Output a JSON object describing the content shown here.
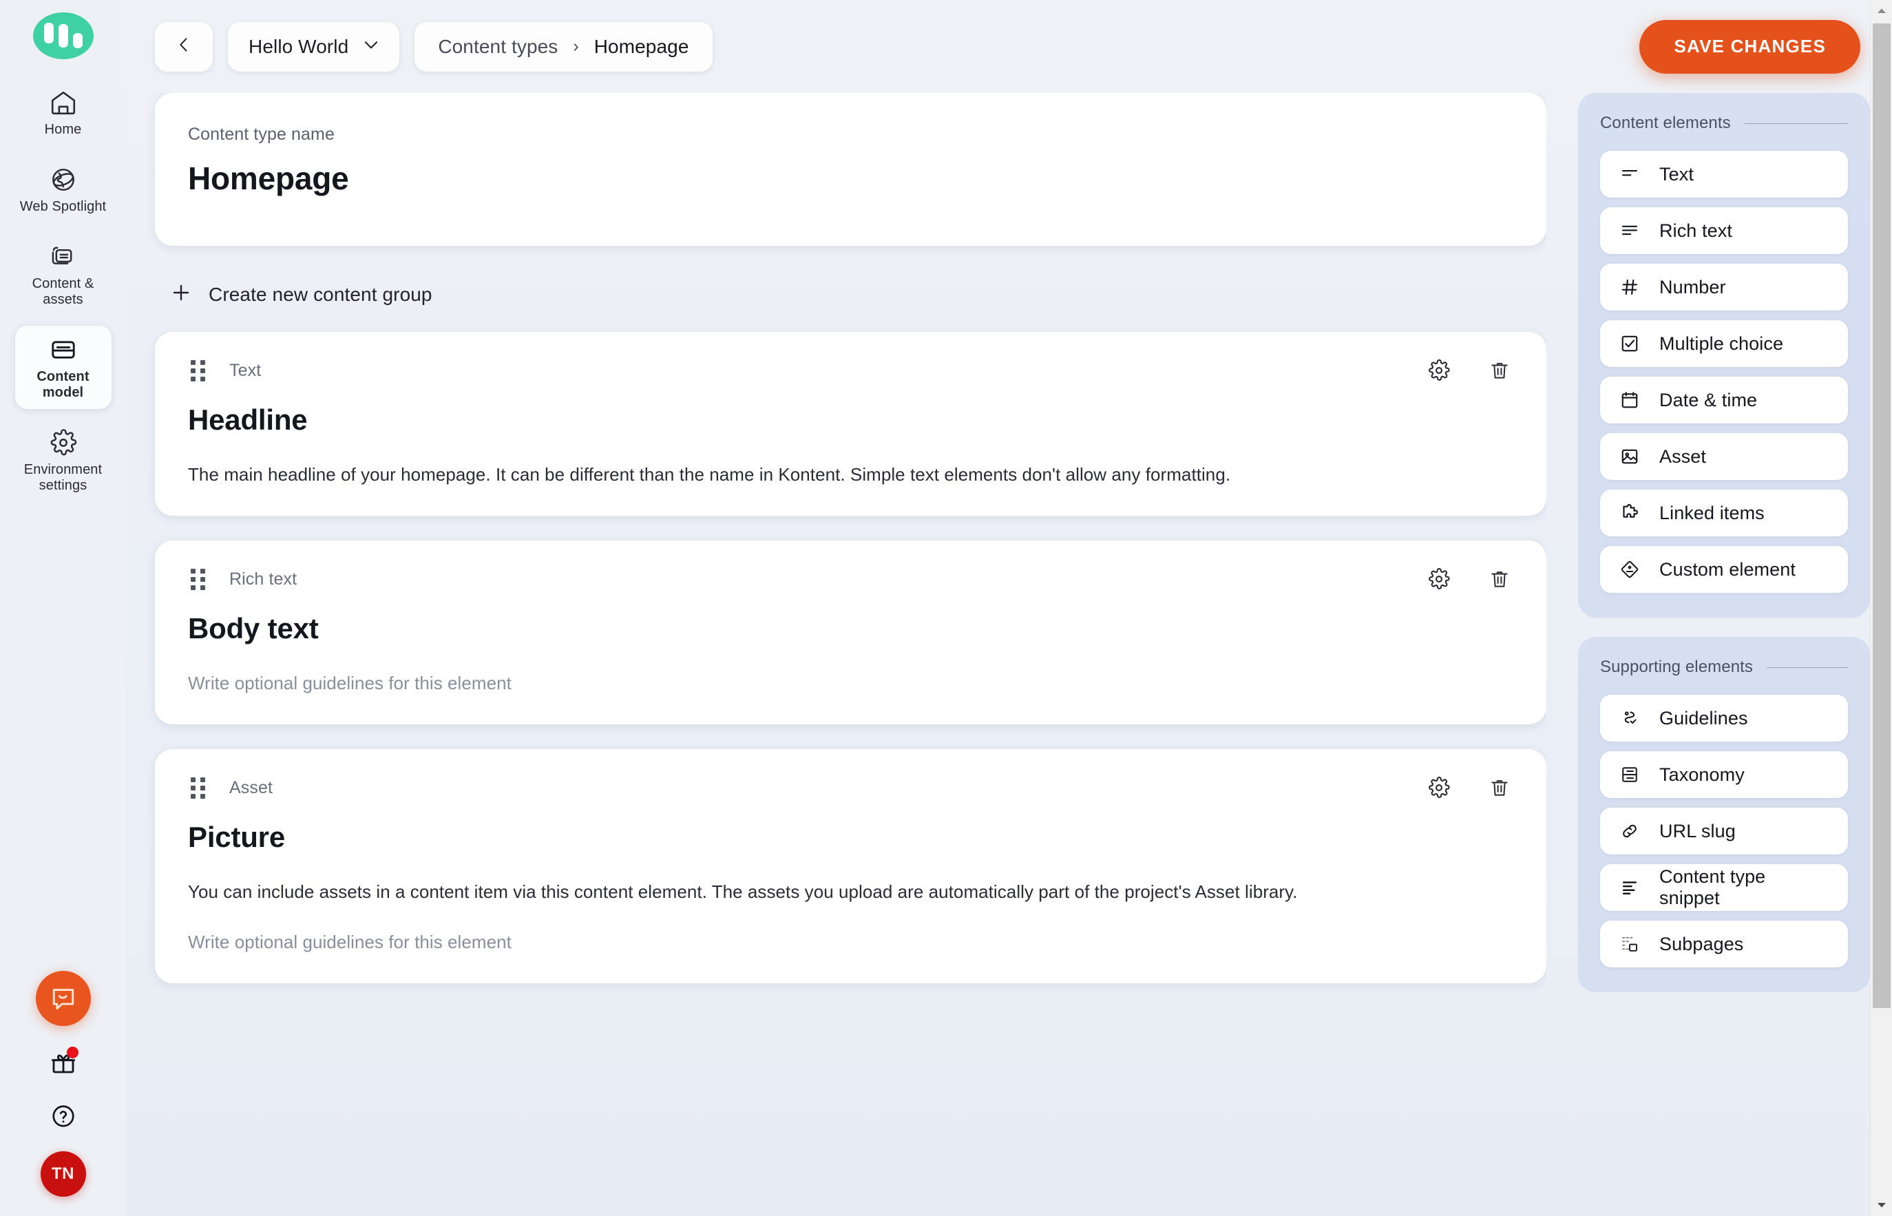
{
  "sidebar": {
    "logo_name": "kontent-ai-logo",
    "items": [
      {
        "label": "Home",
        "icon": "home-icon",
        "active": false
      },
      {
        "label": "Web Spotlight",
        "icon": "globe-icon",
        "active": false
      },
      {
        "label": "Content & assets",
        "icon": "stacked-documents-icon",
        "active": false
      },
      {
        "label": "Content model",
        "icon": "card-icon",
        "active": true
      },
      {
        "label": "Environment settings",
        "icon": "gear-icon",
        "active": false
      }
    ],
    "bottom": {
      "chat_icon": "chat-bubble-icon",
      "gift_icon": "gift-icon",
      "gift_has_notification": true,
      "help_icon": "question-circle-icon",
      "avatar_initials": "TN"
    }
  },
  "topbar": {
    "back_icon": "chevron-left-icon",
    "environment": "Hello World",
    "environment_caret": "chevron-down-icon",
    "breadcrumb": {
      "parent": "Content types",
      "separator": "›",
      "current": "Homepage"
    },
    "save_label": "SAVE CHANGES",
    "save_color": "#e4511a"
  },
  "main": {
    "name_card": {
      "label": "Content type name",
      "value": "Homepage"
    },
    "create_group": {
      "icon": "plus-icon",
      "label": "Create new content group"
    },
    "elements": [
      {
        "type": "Text",
        "title": "Headline",
        "guideline": "The main headline of your homepage. It can be different than the name in Kontent. Simple text elements don't allow any formatting.",
        "guideline_is_placeholder": false,
        "settings_icon": "gear-icon",
        "delete_icon": "trash-icon",
        "drag_icon": "drag-handle-icon"
      },
      {
        "type": "Rich text",
        "title": "Body text",
        "guideline": "Write optional guidelines for this element",
        "guideline_is_placeholder": true,
        "settings_icon": "gear-icon",
        "delete_icon": "trash-icon",
        "drag_icon": "drag-handle-icon"
      },
      {
        "type": "Asset",
        "title": "Picture",
        "guideline": "You can include assets in a content item via this content element. The assets you upload are automatically part of the project's Asset library.",
        "guideline_is_placeholder": false,
        "guideline2": "Write optional guidelines for this element",
        "settings_icon": "gear-icon",
        "delete_icon": "trash-icon",
        "drag_icon": "drag-handle-icon"
      }
    ]
  },
  "rail": {
    "content_elements": {
      "heading": "Content elements",
      "items": [
        {
          "label": "Text",
          "icon": "text-lines-icon"
        },
        {
          "label": "Rich text",
          "icon": "rich-text-icon"
        },
        {
          "label": "Number",
          "icon": "hash-icon"
        },
        {
          "label": "Multiple choice",
          "icon": "checkbox-icon"
        },
        {
          "label": "Date & time",
          "icon": "calendar-icon"
        },
        {
          "label": "Asset",
          "icon": "image-icon"
        },
        {
          "label": "Linked items",
          "icon": "puzzle-icon"
        },
        {
          "label": "Custom element",
          "icon": "custom-element-icon"
        }
      ]
    },
    "supporting_elements": {
      "heading": "Supporting elements",
      "items": [
        {
          "label": "Guidelines",
          "icon": "guidelines-icon"
        },
        {
          "label": "Taxonomy",
          "icon": "taxonomy-icon"
        },
        {
          "label": "URL slug",
          "icon": "link-icon"
        },
        {
          "label": "Content type snippet",
          "icon": "snippet-icon"
        },
        {
          "label": "Subpages",
          "icon": "subpages-icon"
        }
      ]
    }
  },
  "scrollbar": {
    "up_icon": "scroll-up-arrow-icon",
    "down_icon": "scroll-down-arrow-icon"
  }
}
